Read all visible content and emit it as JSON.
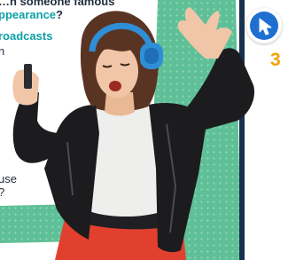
{
  "text": {
    "line1": "…n someone famous",
    "line2_accent": "ppearance",
    "line2_end": "?",
    "line3": "roadcasts",
    "line4": "n",
    "line5": "use",
    "line6": "?"
  },
  "step_number": "3",
  "cursor_button": {
    "icon": "cursor-arrow-icon"
  },
  "colors": {
    "teal_accent": "#0e9fa8",
    "dark_text": "#1f2d3d",
    "green_panel": "#5fbf97",
    "navy_stripe": "#16324f",
    "cursor_blue": "#1f6fd1",
    "number_orange": "#f2a20a",
    "jacket": "#1c1c1f",
    "skirt": "#e2402f",
    "headphones": "#2f8fd6"
  }
}
